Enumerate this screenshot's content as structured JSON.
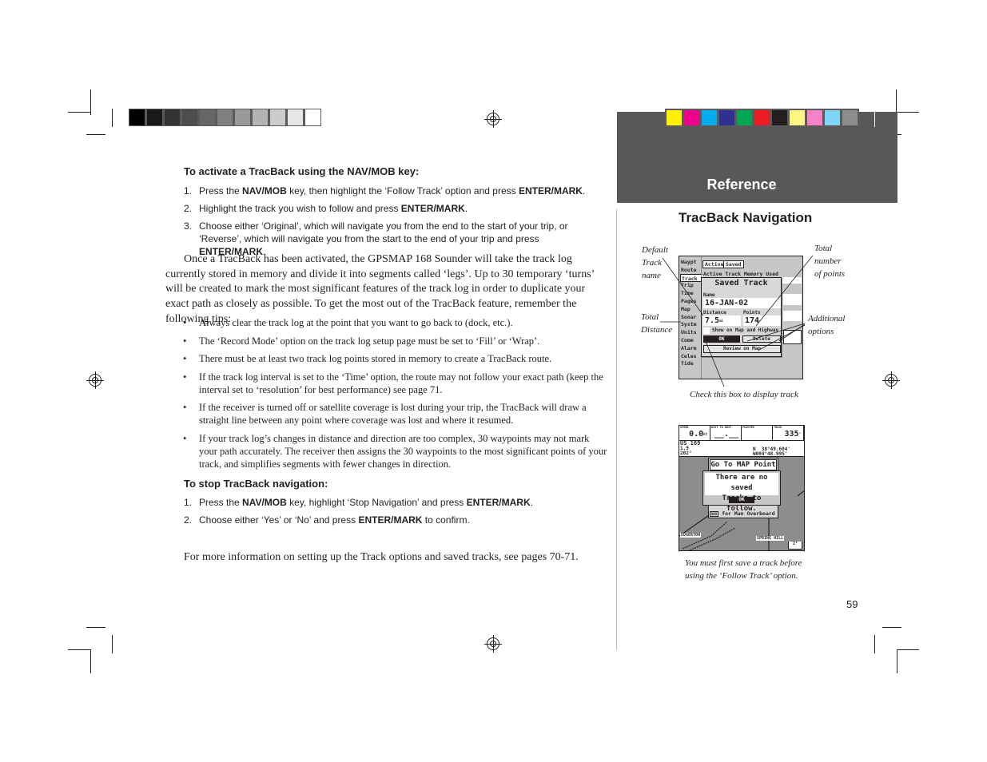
{
  "calibration": {
    "grayscale": [
      "#000000",
      "#1a1a1a",
      "#333333",
      "#4d4d4d",
      "#666666",
      "#808080",
      "#999999",
      "#b3b3b3",
      "#cccccc",
      "#e6e6e6",
      "#ffffff"
    ],
    "colors": [
      "#fff200",
      "#ec008c",
      "#00aeef",
      "#2e3192",
      "#00a651",
      "#ed1c24",
      "#231f20",
      "#fff582",
      "#f383c4",
      "#7fd3f7",
      "#8e8c8d"
    ]
  },
  "header": {
    "section": "Reference",
    "title": "TracBack Navigation",
    "accent_color": "#595758"
  },
  "activate": {
    "heading": "To activate a TracBack using the NAV/MOB key:",
    "steps": [
      {
        "num": "1.",
        "pre": "Press the ",
        "b1": "NAV/MOB",
        "mid": " key, then highlight the ‘Follow Track’ option and press ",
        "b2": "ENTER/MARK",
        "post": "."
      },
      {
        "num": "2.",
        "pre": "Highlight the track you wish to follow and press ",
        "b1": "ENTER/MARK",
        "post": "."
      },
      {
        "num": "3.",
        "pre": "Choose either ‘Original’, which will navigate you from the end to the start of your trip, or ‘Reverse’, which will navigate you from the start to the end of your trip and press ",
        "b1": "ENTER/MARK",
        "post": "."
      }
    ]
  },
  "body_paragraph": "Once a TracBack has been activated, the GPSMAP 168 Sounder will take the track log currently stored in memory and divide it into segments called ‘legs’. Up to 30 temporary ‘turns’ will be created to mark the most significant features of the track log in order to duplicate your exact path as closely as possible. To get the most out of the TracBack feature, remember the following tips:",
  "tips": [
    "Always clear the track log at the point that you want to go back to (dock, etc.).",
    "The ‘Record Mode’ option on the track log setup page must be set to ‘Fill’ or ‘Wrap’.",
    "There must be at least two track log points stored in memory to create a TracBack route.",
    "If the track log interval is set to the ‘Time’ option, the route may not follow your exact path (keep the interval set to ‘resolution’ for best performance) see page 71.",
    "If the receiver is turned off or satellite coverage is lost during your trip, the TracBack will draw a straight line between any point where coverage was lost and where it resumed.",
    "If your track log’s changes in distance and direction are too complex, 30 waypoints may not mark your path accurately. The receiver then assigns the 30 waypoints to the most significant points of your track, and simplifies segments with fewer changes in direction."
  ],
  "stop": {
    "heading": "To stop TracBack navigation:",
    "steps": [
      {
        "num": "1.",
        "pre": "Press the ",
        "b1": "NAV/MOB",
        "mid": " key, highlight ‘Stop Navigation’ and press ",
        "b2": "ENTER/MARK",
        "post": "."
      },
      {
        "num": "2.",
        "pre": "Choose either ‘Yes’ or ‘No’ and press ",
        "b1": "ENTER/MARK",
        "post": " to confirm."
      }
    ]
  },
  "more_info": "For more information on setting up the Track options and saved tracks, see pages 70-71.",
  "figure1": {
    "callouts": {
      "default_name": [
        "Default",
        "Track",
        "name"
      ],
      "total_points": [
        "Total",
        "number",
        "of points"
      ],
      "total_distance": [
        "Total",
        "Distance"
      ],
      "additional": [
        "Additional",
        "options"
      ],
      "checkbox": "Check this box to display track"
    },
    "menu": [
      "Waypt",
      "Route",
      "Track",
      "Trip",
      "Time",
      "Pages",
      "Map",
      "Sonar",
      "Systm",
      "Units",
      "Comm",
      "Alarm",
      "Celes",
      "Tide"
    ],
    "selected_menu": "Track",
    "tabs": [
      "Active",
      "Saved"
    ],
    "memory_label": "Active Track Memory Used",
    "dialog_title": "Saved Track",
    "name_label": "Name",
    "name_value": "16-JAN-02",
    "distance_label": "Distance",
    "distance_value": "7.5",
    "distance_unit": "mi",
    "points_label": "Points",
    "points_value": "174",
    "checkbox_label": "Show on Map and Highway",
    "ok_button": "OK",
    "delete_button": "Delete",
    "review_button": "Review on Map"
  },
  "figure2": {
    "fields": [
      {
        "label": "SPEED",
        "value": "0.0",
        "unit": "kt"
      },
      {
        "label": "DIST TO NEXT",
        "value": "__.__",
        "unit": ""
      },
      {
        "label": "POINTER",
        "value": "",
        "unit": ""
      },
      {
        "label": "TRACK",
        "value": "335",
        "unit": "°"
      }
    ],
    "info_name": "US 169",
    "info_dist": "1.9",
    "info_brg": "202°",
    "lat": "N  38°49.604'",
    "lon": "W094°48.995'",
    "menu_title": "Go To MAP Point",
    "message_line1": "There are no saved",
    "message_line2": "Tracks to follow.",
    "ok_button": "OK",
    "mob_label": "for Man Overboard",
    "nav_key": "NAV",
    "place1": "EDGERTON",
    "place2": "SPRING HILL",
    "scale": "2³",
    "caption": [
      "You must first save a track before",
      "using the ‘Follow Track’ option."
    ]
  },
  "page_number": "59"
}
